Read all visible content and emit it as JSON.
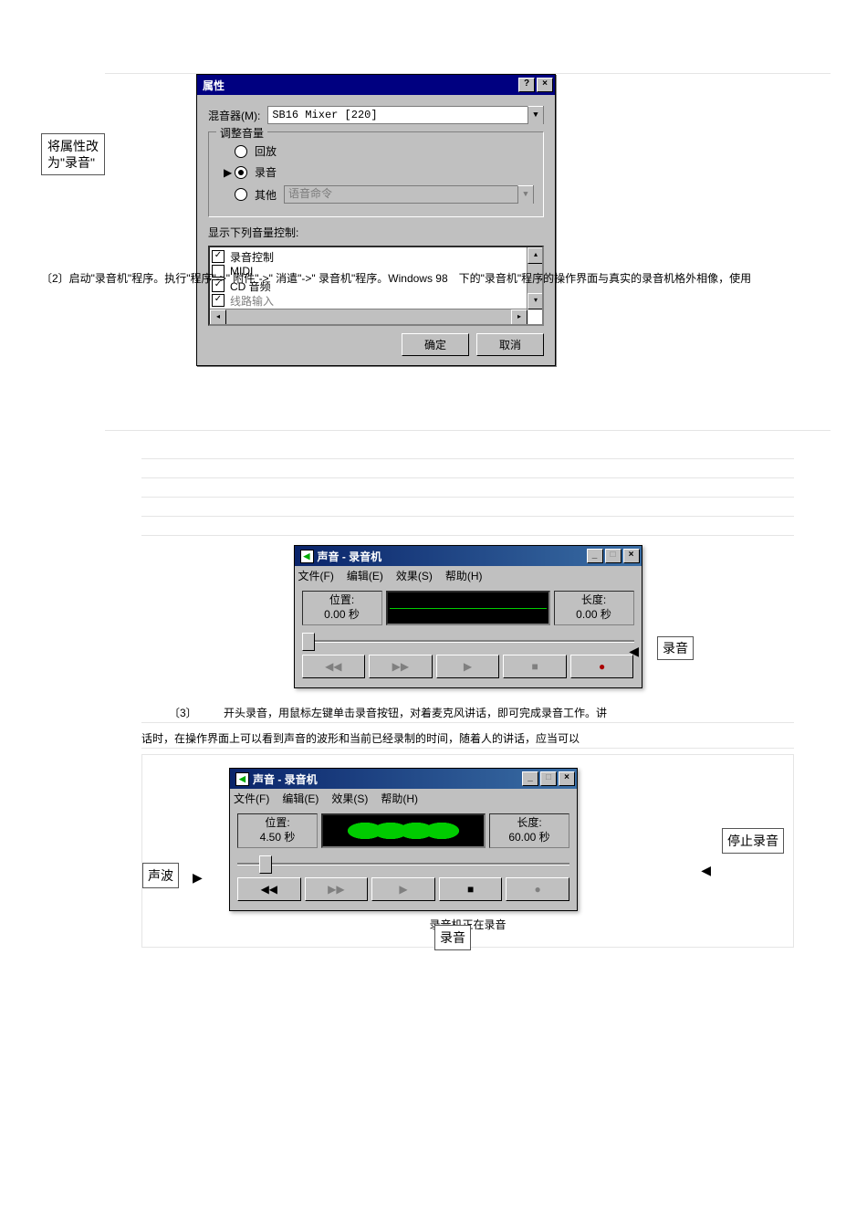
{
  "properties_dialog": {
    "title": "属性",
    "mixer_label": "混音器(M):",
    "mixer_value": "SB16 Mixer [220]",
    "group_title": "调整音量",
    "radio_playback": "回放",
    "radio_record": "录音",
    "radio_other": "其他",
    "other_dd": "语音命令",
    "list_label": "显示下列音量控制:",
    "items": {
      "record_ctrl": "录音控制",
      "midi": "MIDI",
      "cd_audio": "CD 音频",
      "line_in": "线路输入"
    },
    "ok": "确定",
    "cancel": "取消"
  },
  "callouts": {
    "change_to_record": "将属性改\n为\"录音\"",
    "record": "录音",
    "sound_wave": "声波",
    "stop_record": "停止录音",
    "ryin": "录音"
  },
  "instruction_step2": "〔2〕启动\"录音机\"程序。执行\"程序\"->\" 附件\"->\" 消遣\"->\" 录音机\"程序。Windows 98　下的\"录音机\"程序的操作界面与真实的录音机格外相像，使用",
  "instruction_step3_num": "〔3〕",
  "instruction_step3": "开头录音，用鼠标左键单击录音按钮，对着麦克风讲话，即可完成录音工作。讲",
  "instruction_step3b": "话时，在操作界面上可以看到声音的波形和当前已经录制的时间，随着人的讲话，应当可以",
  "recorder": {
    "title": "声音 - 录音机",
    "menu_file": "文件(F)",
    "menu_edit": "编辑(E)",
    "menu_effect": "效果(S)",
    "menu_help": "帮助(H)",
    "pos_label": "位置:",
    "len_label": "长度:",
    "pos_value_1": "0.00 秒",
    "len_value_1": "0.00 秒",
    "pos_value_2": "4.50 秒",
    "len_value_2": "60.00 秒"
  },
  "caption2": "录音机正在录音"
}
